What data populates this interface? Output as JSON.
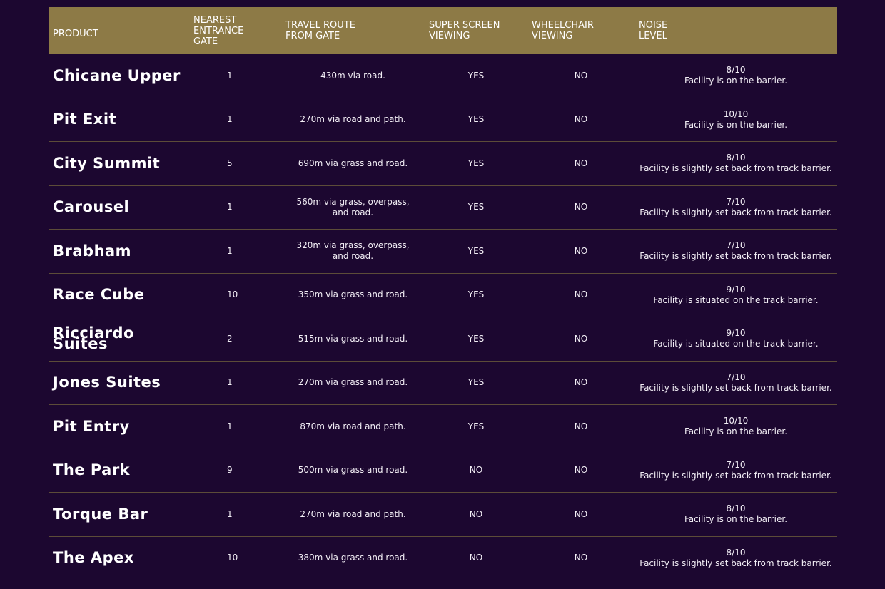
{
  "table": {
    "headers": [
      "PRODUCT",
      "NEAREST\nENTRANCE\nGATE",
      "TRAVEL ROUTE\nFROM GATE",
      "SUPER SCREEN\nVIEWING",
      "WHEELCHAIR\nVIEWING",
      "NOISE\nLEVEL"
    ],
    "rows": [
      {
        "product": "Chicane Upper",
        "gate": "1",
        "route": "430m via road.",
        "screen": "YES",
        "wheelchair": "NO",
        "noise": "8/10",
        "noise_note": "Facility is on the barrier."
      },
      {
        "product": "Pit Exit",
        "gate": "1",
        "route": "270m via road and path.",
        "screen": "YES",
        "wheelchair": "NO",
        "noise": "10/10",
        "noise_note": "Facility is on the barrier."
      },
      {
        "product": "City Summit",
        "gate": "5",
        "route": "690m via grass and road.",
        "screen": "YES",
        "wheelchair": "NO",
        "noise": "8/10",
        "noise_note": "Facility is slightly set back from track barrier."
      },
      {
        "product": "Carousel",
        "gate": "1",
        "route": "560m via grass, overpass, and road.",
        "screen": "YES",
        "wheelchair": "NO",
        "noise": "7/10",
        "noise_note": "Facility is slightly set back from track barrier."
      },
      {
        "product": "Brabham",
        "gate": "1",
        "route": "320m via grass, overpass, and road.",
        "screen": "YES",
        "wheelchair": "NO",
        "noise": "7/10",
        "noise_note": "Facility is slightly set back from track barrier."
      },
      {
        "product": "Race Cube",
        "gate": "10",
        "route": "350m via grass and road.",
        "screen": "YES",
        "wheelchair": "NO",
        "noise": "9/10",
        "noise_note": "Facility is situated on the track barrier."
      },
      {
        "product": "Ricciardo Suites",
        "gate": "2",
        "route": "515m via grass and road.",
        "screen": "YES",
        "wheelchair": "NO",
        "noise": "9/10",
        "noise_note": "Facility is situated on the track barrier."
      },
      {
        "product": "Jones Suites",
        "gate": "1",
        "route": "270m via grass and road.",
        "screen": "YES",
        "wheelchair": "NO",
        "noise": "7/10",
        "noise_note": "Facility is slightly set back from track barrier."
      },
      {
        "product": "Pit Entry",
        "gate": "1",
        "route": "870m via road and path.",
        "screen": "YES",
        "wheelchair": "NO",
        "noise": "10/10",
        "noise_note": "Facility is on the barrier."
      },
      {
        "product": "The Park",
        "gate": "9",
        "route": "500m via grass and road.",
        "screen": "NO",
        "wheelchair": "NO",
        "noise": "7/10",
        "noise_note": "Facility is slightly set back from track barrier."
      },
      {
        "product": "Torque Bar",
        "gate": "1",
        "route": "270m via road and path.",
        "screen": "NO",
        "wheelchair": "NO",
        "noise": "8/10",
        "noise_note": "Facility is on the barrier."
      },
      {
        "product": "The Apex",
        "gate": "10",
        "route": "380m via grass and road.",
        "screen": "NO",
        "wheelchair": "NO",
        "noise": "8/10",
        "noise_note": "Facility is slightly set back from track barrier."
      }
    ]
  },
  "colors": {
    "background": "#1c0730",
    "header": "#8d7a46",
    "divider": "#5c4c38"
  }
}
